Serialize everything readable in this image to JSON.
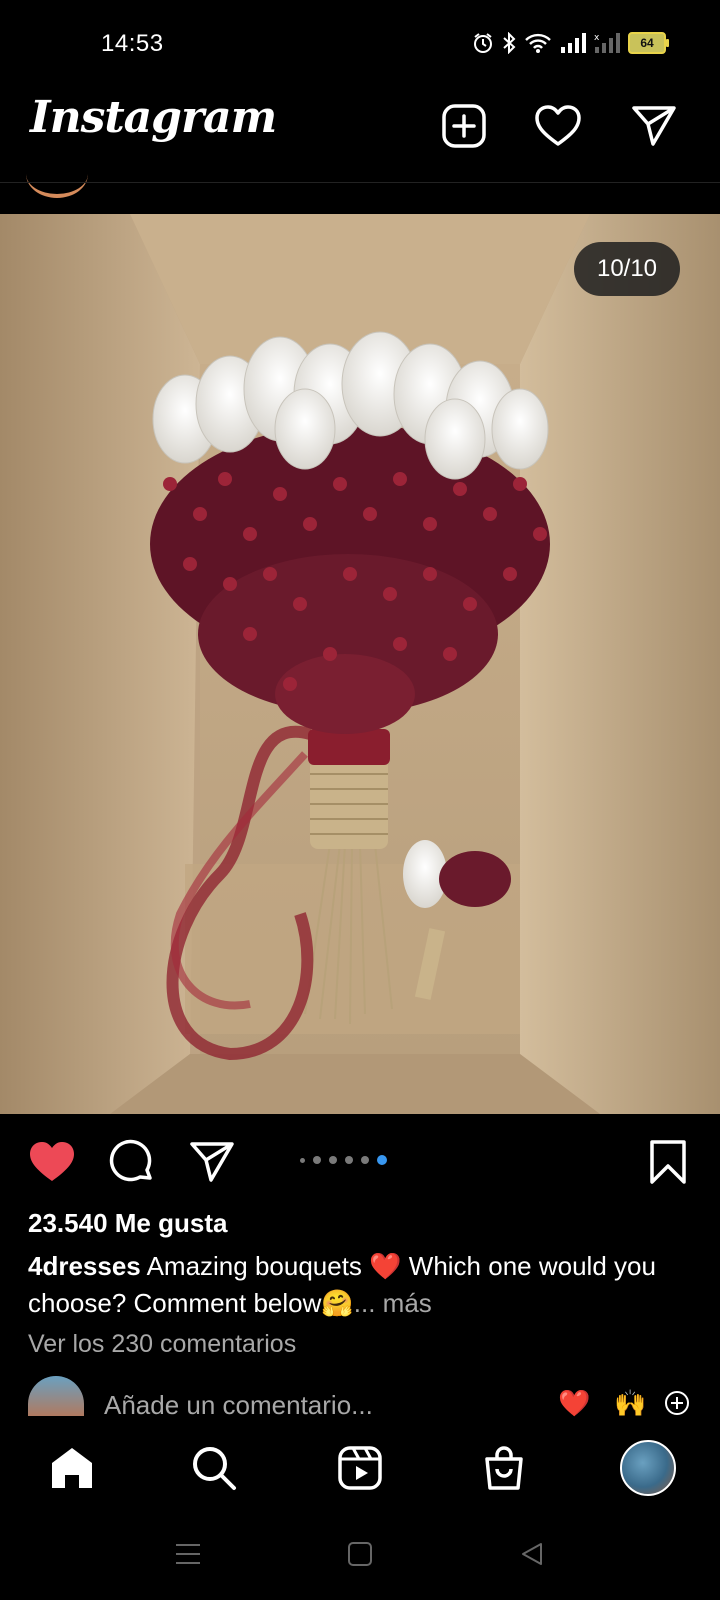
{
  "status_bar": {
    "time": "14:53",
    "battery": "64",
    "icons": [
      "alarm-icon",
      "bluetooth-icon",
      "wifi-icon",
      "signal-icon",
      "signal-2-icon",
      "battery-icon"
    ]
  },
  "header": {
    "logo_text": "Instagram",
    "icons": [
      "new-post-icon",
      "heart-icon",
      "direct-message-icon"
    ]
  },
  "post": {
    "carousel_counter": "10/10",
    "image_subject": "bouquet-of-white-tulips-and-burgundy-dried-flowers-in-cardboard-box",
    "likes_text": "23.540 Me gusta",
    "caption": {
      "username": "4dresses",
      "text_part1": "Amazing bouquets",
      "emoji1": "❤️",
      "text_part2": "Which one would you choose? Comment below",
      "emoji2": "🤗",
      "more": "... más"
    },
    "view_comments": "Ver los 230 comentarios",
    "comment_placeholder": "Añade un comentario...",
    "quick_reactions": [
      "❤️",
      "🙌"
    ],
    "carousel_dots": {
      "total": 6,
      "active_index": 5
    }
  },
  "bottom_nav": {
    "items": [
      "home-icon",
      "search-icon",
      "reels-icon",
      "shop-icon",
      "profile-avatar"
    ]
  },
  "system_nav": [
    "menu-icon",
    "home-square-icon",
    "back-icon"
  ],
  "colors": {
    "background": "#000000",
    "like_red": "#ed4956",
    "dot_active": "#3897f0",
    "muted_text": "#a8a8a8"
  }
}
